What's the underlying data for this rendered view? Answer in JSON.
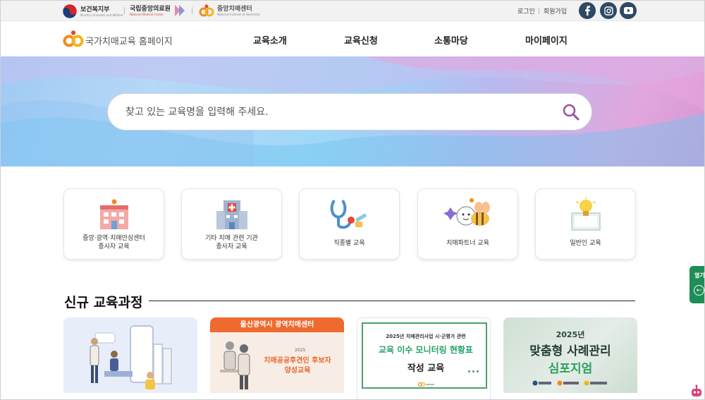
{
  "topbar": {
    "org1": {
      "name": "보건복지부",
      "sub": "Ministry of Health and Welfare"
    },
    "org2": {
      "name": "국립중앙의료원",
      "sub": "National Medical Center"
    },
    "org3": {
      "name": "중앙치매센터",
      "sub": "National Institute of Dementia"
    },
    "login": "로그인",
    "signup": "회원가입",
    "social": [
      "facebook-icon",
      "instagram-icon",
      "youtube-icon"
    ]
  },
  "header": {
    "site_title": "국가치매교육 홈페이지",
    "nav": [
      "교육소개",
      "교육신청",
      "소통마당",
      "마이페이지"
    ]
  },
  "search": {
    "placeholder": "찾고 있는 교육명을 입력해 주세요."
  },
  "categories": [
    {
      "label": "중앙·광역·치매안심센터\n종사자 교육",
      "icon": "building-icon"
    },
    {
      "label": "기타 치매 관련 기관\n종사자 교육",
      "icon": "hospital-icon"
    },
    {
      "label": "직종별 교육",
      "icon": "stethoscope-icon"
    },
    {
      "label": "치매파트너 교육",
      "icon": "partner-bee-icon"
    },
    {
      "label": "일반인 교육",
      "icon": "lightbulb-icon"
    }
  ],
  "new_courses": {
    "title": "신규 교육과정",
    "cards": [
      {
        "kind": "illustration"
      },
      {
        "header": "울산광역시 광역치매센터",
        "year": "2025",
        "line1": "치매공공후견인 후보자",
        "line2": "양성교육"
      },
      {
        "line1": "2025년 치매관리사업 시·군평가 관련",
        "line2": "교육 이수 모니터링 현황표",
        "line3": "작성 교육"
      },
      {
        "year": "2025년",
        "line1": "맞춤형 사례관리",
        "line2": "심포지엄"
      }
    ]
  },
  "side_tab": {
    "label": "열기"
  },
  "colors": {
    "accent_green": "#1f8d57",
    "orange": "#ef6a2f",
    "navy": "#2f4963"
  }
}
